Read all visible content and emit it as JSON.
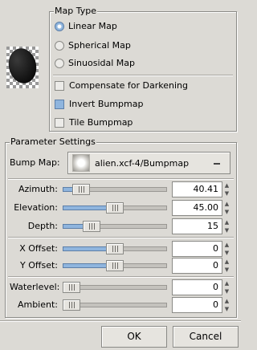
{
  "map_type": {
    "title": "Map Type",
    "options": [
      {
        "label": "Linear Map",
        "selected": true
      },
      {
        "label": "Spherical Map",
        "selected": false
      },
      {
        "label": "Sinuosidal Map",
        "selected": false
      }
    ],
    "checks": [
      {
        "label": "Compensate for Darkening",
        "checked": false
      },
      {
        "label": "Invert Bumpmap",
        "checked": true
      },
      {
        "label": "Tile Bumpmap",
        "checked": false
      }
    ]
  },
  "params": {
    "title": "Parameter Settings",
    "bump_map_label": "Bump Map:",
    "bump_map_value": "alien.xcf-4/Bumpmap",
    "sliders": [
      {
        "label": "Azimuth:",
        "value": "40.41",
        "fraction": 0.11
      },
      {
        "label": "Elevation:",
        "value": "45.00",
        "fraction": 0.5
      },
      {
        "label": "Depth:",
        "value": "15",
        "fraction": 0.23
      },
      {
        "label": "X Offset:",
        "value": "0",
        "fraction": 0.5
      },
      {
        "label": "Y Offset:",
        "value": "0",
        "fraction": 0.5
      },
      {
        "label": "Waterlevel:",
        "value": "0",
        "fraction": 0.0
      },
      {
        "label": "Ambient:",
        "value": "0",
        "fraction": 0.0
      }
    ]
  },
  "buttons": {
    "ok": "OK",
    "cancel": "Cancel"
  },
  "colors": {
    "accent": "#8fb5de",
    "background": "#dcdad5"
  }
}
